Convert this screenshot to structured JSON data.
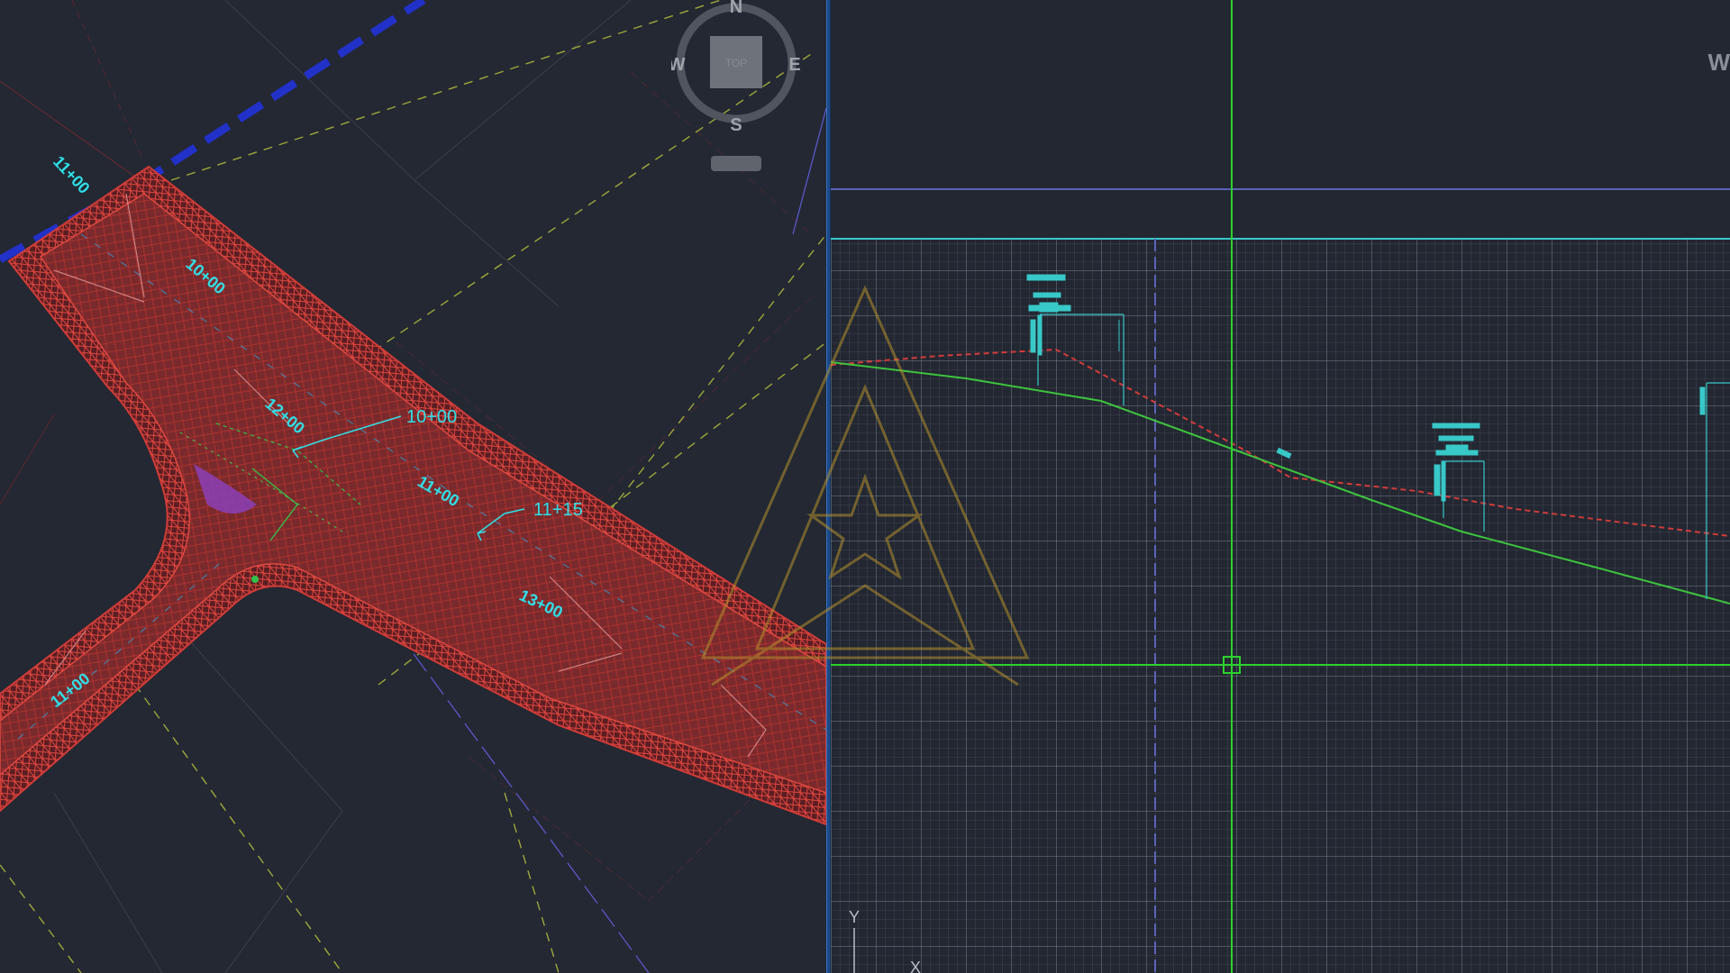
{
  "app": {
    "type": "CAD drawing workspace"
  },
  "viewcube": {
    "north": "N",
    "south": "S",
    "east": "E",
    "west": "W",
    "face": "TOP"
  },
  "plan_view": {
    "station_labels": [
      "11+00",
      "10+00",
      "12+00",
      "10+00",
      "11+00",
      "11+15",
      "13+00",
      "11+00"
    ],
    "callouts": [
      "10+00",
      "11+15"
    ]
  },
  "profile_view": {
    "edge_letter": "W",
    "ucs": {
      "y_label": "Y",
      "x_label": "X"
    }
  },
  "colors": {
    "background": "#222832",
    "road_fill": "#7a2a2a",
    "road_mesh": "#d33a36",
    "station_text": "#2fe0e8",
    "grid_line": "#8891a3",
    "crosshair": "#2ed12e",
    "profile_border": "#38c8c8",
    "design_profile": "#3ec43e",
    "existing_ground": "#d23b3b",
    "divider": "#1b4a8a",
    "watermark": "#b4902c",
    "alignment_dash": "#2231c8"
  }
}
